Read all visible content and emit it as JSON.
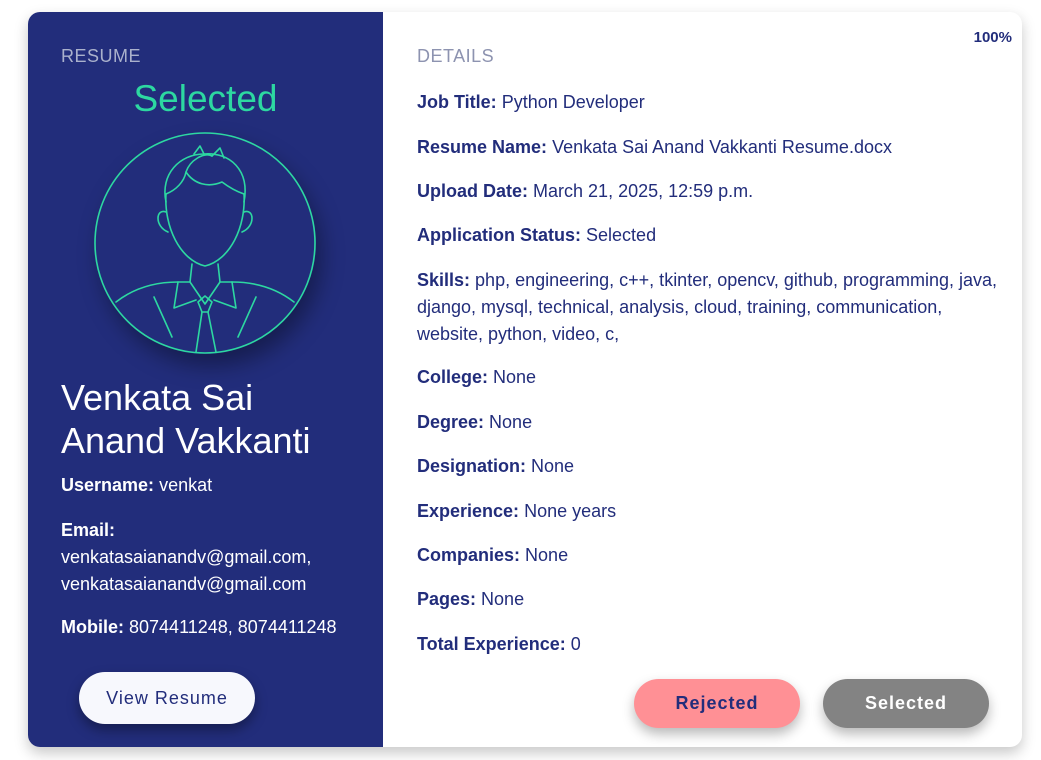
{
  "progress": {
    "label": "100%",
    "value": 100
  },
  "resume_panel": {
    "heading": "RESUME",
    "status": "Selected",
    "avatar_icon": "person-avatar-icon",
    "full_name": "Venkata Sai Anand Vakkanti",
    "username_label": "Username:",
    "username": "venkat",
    "email_label": "Email:",
    "email": "venkatasaianandv@gmail.com, venkatasaianandv@gmail.com",
    "mobile_label": "Mobile:",
    "mobile": "8074411248, 8074411248",
    "view_button": "View Resume"
  },
  "details": {
    "heading": "DETAILS",
    "fields": [
      {
        "label": "Job Title:",
        "value": "Python Developer"
      },
      {
        "label": "Resume Name:",
        "value": "Venkata Sai Anand Vakkanti Resume.docx"
      },
      {
        "label": "Upload Date:",
        "value": "March 21, 2025, 12:59 p.m."
      },
      {
        "label": "Application Status:",
        "value": "Selected"
      },
      {
        "label": "Skills:",
        "value": "php, engineering, c++, tkinter, opencv, github, programming, java, django, mysql, technical, analysis, cloud, training, communication, website, python, video, c,"
      },
      {
        "label": "College:",
        "value": "None"
      },
      {
        "label": "Degree:",
        "value": "None"
      },
      {
        "label": "Designation:",
        "value": "None"
      },
      {
        "label": "Experience:",
        "value": "None years"
      },
      {
        "label": "Companies:",
        "value": "None"
      },
      {
        "label": "Pages:",
        "value": "None"
      },
      {
        "label": "Total Experience:",
        "value": "0"
      }
    ]
  },
  "actions": {
    "rejected": "Rejected",
    "selected": "Selected"
  },
  "colors": {
    "panel": "#222d7b",
    "accent_green": "#2dd8a1",
    "rejected": "#ff9095",
    "selected": "#838383"
  }
}
